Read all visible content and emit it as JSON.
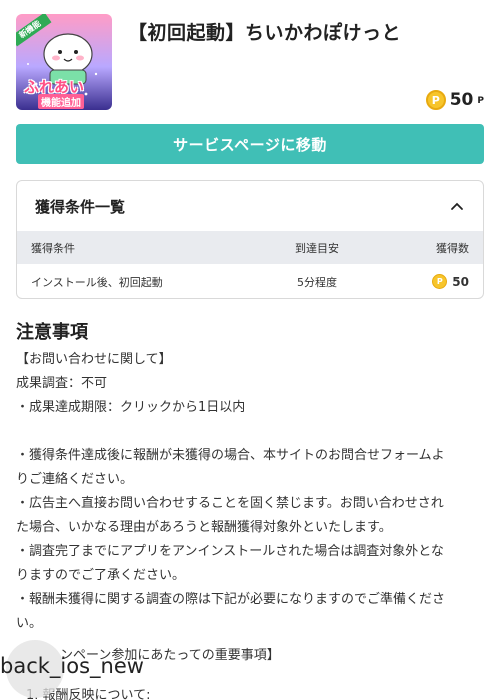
{
  "app": {
    "title": "【初回起動】ちいかわぽけっと",
    "icon_badge": "新機能",
    "icon_caption_main": "ふれあい",
    "icon_caption_sub": "機能追加",
    "points_value": "50",
    "points_unit": "P",
    "coin_symbol": "P"
  },
  "service_button": {
    "label": "サービスページに移動"
  },
  "conditions": {
    "title": "獲得条件一覧",
    "columns": [
      "獲得条件",
      "到達目安",
      "獲得数"
    ],
    "rows": [
      {
        "condition": "インストール後、初回起動",
        "time": "5分程度",
        "reward": "50"
      }
    ]
  },
  "notes": {
    "title": "注意事項",
    "lines": [
      "【お問い合わせに関して】",
      "成果調査：不可",
      "・成果達成期限：クリックから1日以内",
      "",
      "・獲得条件達成後に報酬が未獲得の場合、本サイトのお問合せフォームよ",
      "りご連絡ください。",
      "・広告主へ直接お問い合わせすることを固く禁じます。お問い合わせされ",
      "た場合、いかなる理由があろうと報酬獲得対象外といたします。",
      "・調査完了までにアプリをアンインストールされた場合は調査対象外とな",
      "りますのでご了承ください。",
      "・報酬未獲得に関する調査の際は下記が必要になりますのでご準備くださ",
      "い。"
    ],
    "campaign_heading": "ンペーン参加にあたっての重要事項】",
    "list_item_1": "1.  報酬反映について:"
  },
  "back_button": {
    "label": "back_ios_new"
  },
  "colors": {
    "accent": "#40bfb6",
    "coin": "#f7c52b",
    "table_header": "#e9ebef"
  }
}
